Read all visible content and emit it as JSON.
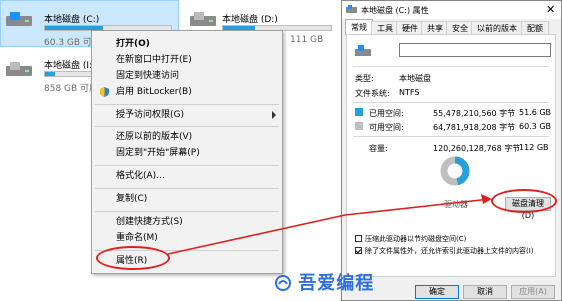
{
  "explorer": {
    "drives": [
      {
        "name": "本地磁盘 (C:)",
        "size": "60.3 GB 可用",
        "fill": 0.46,
        "selected": true
      },
      {
        "name": "本地磁盘 (D:)",
        "size": "111 GB",
        "fill": 0.3,
        "selected": false
      },
      {
        "name": "本地磁盘 (I:)",
        "size": "858 GB 可用",
        "fill": 0.2,
        "selected": false
      }
    ]
  },
  "context_menu": {
    "items": [
      {
        "label": "打开(O)",
        "bold": true
      },
      {
        "label": "在新窗口中打开(E)"
      },
      {
        "label": "固定到快速访问"
      },
      {
        "label": "启用 BitLocker(B)",
        "icon": "shield-icon"
      },
      {
        "label": "授予访问权限(G)",
        "submenu": true
      },
      {
        "label": "还原以前的版本(V)"
      },
      {
        "label": "固定到\"开始\"屏幕(P)"
      },
      {
        "label": "格式化(A)..."
      },
      {
        "label": "复制(C)"
      },
      {
        "label": "创建快捷方式(S)"
      },
      {
        "label": "重命名(M)"
      },
      {
        "label": "属性(R)"
      }
    ]
  },
  "dialog": {
    "title": "本地磁盘 (C:) 属性",
    "tabs": [
      "常规",
      "工具",
      "硬件",
      "共享",
      "安全",
      "以前的版本",
      "配额"
    ],
    "active_tab": 0,
    "type_label": "类型:",
    "type_value": "本地磁盘",
    "fs_label": "文件系统:",
    "fs_value": "NTFS",
    "used_label": "已用空间:",
    "used_bytes": "55,478,210,560 字节",
    "used_gb": "51.6 GB",
    "free_label": "可用空间:",
    "free_bytes": "64,781,918,208 字节",
    "free_gb": "60.3 GB",
    "cap_label": "容量:",
    "cap_bytes": "120,260,128,768 字节",
    "cap_gb": "112 GB",
    "drive_caption": "驱动器",
    "cleanup_button": "磁盘清理(D)",
    "compress_label": "压缩此驱动器以节约磁盘空间(C)",
    "index_label": "除了文件属性外，还允许索引此驱动器上文件的内容(I)",
    "compress_checked": false,
    "index_checked": true,
    "ok_button": "确定",
    "cancel_button": "取消",
    "apply_button": "应用(A)",
    "used_fraction": 0.461,
    "colors": {
      "used": "#26a0da",
      "free": "#bfbfbf"
    }
  },
  "watermark": "吾爱编程"
}
